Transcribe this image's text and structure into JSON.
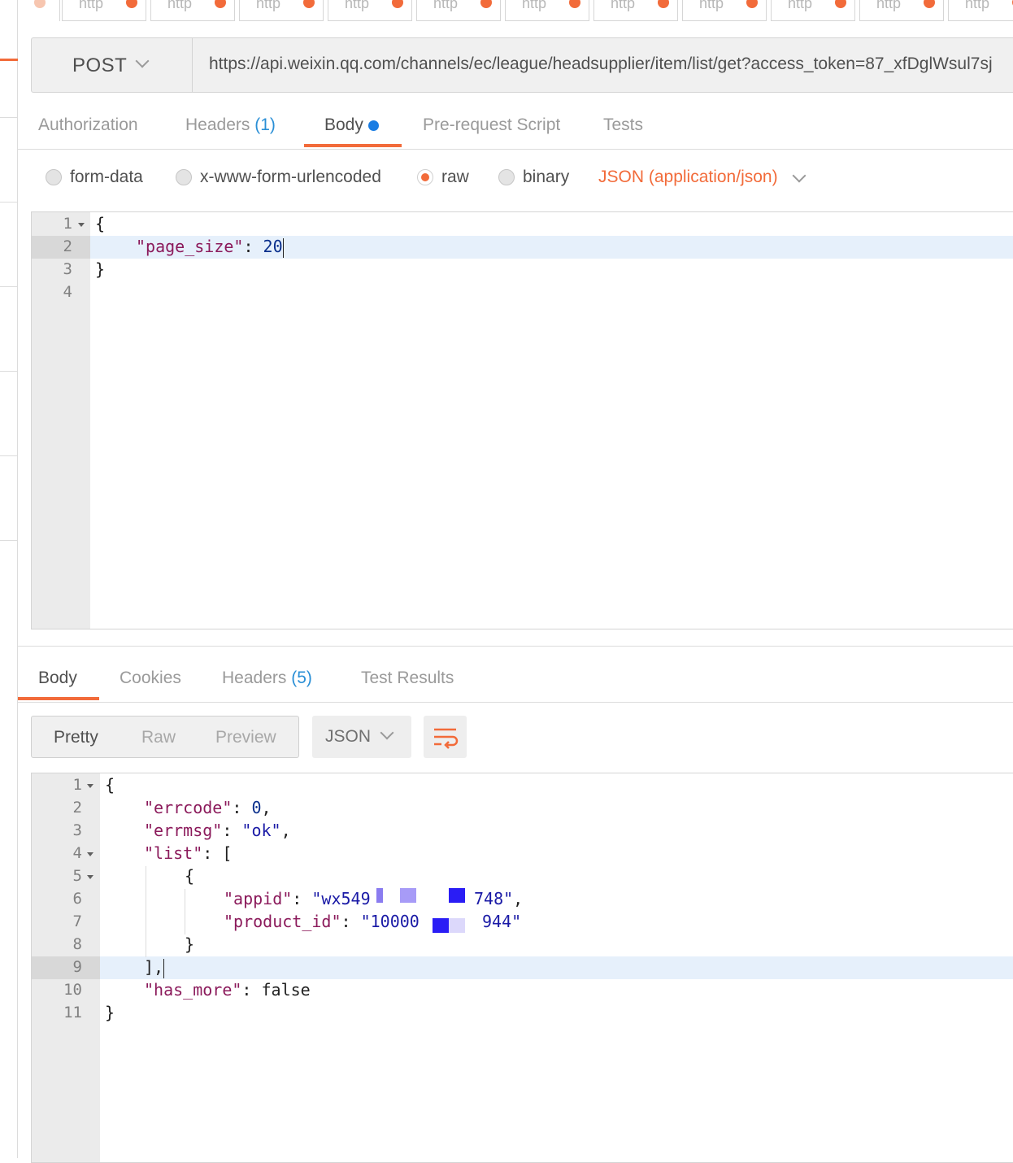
{
  "colors": {
    "accent": "#f26b3a",
    "link": "#2a8fd6",
    "dot_blue": "#1a7de3"
  },
  "tabs_strip": {
    "tab_label": "http",
    "count": 11
  },
  "request": {
    "method": "POST",
    "url": "https://api.weixin.qq.com/channels/ec/league/headsupplier/item/list/get?access_token=87_xfDglWsul7sj"
  },
  "request_tabs": [
    {
      "label": "Authorization",
      "count": ""
    },
    {
      "label": "Headers",
      "count": "(1)"
    },
    {
      "label": "Body",
      "count": "",
      "active": true,
      "dot": true
    },
    {
      "label": "Pre-request Script",
      "count": ""
    },
    {
      "label": "Tests",
      "count": ""
    }
  ],
  "body_types": {
    "form_data": "form-data",
    "urlencoded": "x-www-form-urlencoded",
    "raw": "raw",
    "binary": "binary",
    "selected": "raw",
    "content_type": "JSON (application/json)"
  },
  "request_body": {
    "line_numbers": [
      "1",
      "2",
      "3",
      "4"
    ],
    "open": "{",
    "key": "\"page_size\"",
    "colon": ": ",
    "value": "20",
    "close": "}"
  },
  "response_tabs": [
    {
      "label": "Body",
      "count": "",
      "active": true
    },
    {
      "label": "Cookies",
      "count": ""
    },
    {
      "label": "Headers",
      "count": "(5)"
    },
    {
      "label": "Test Results",
      "count": ""
    }
  ],
  "response_view": {
    "modes": [
      "Pretty",
      "Raw",
      "Preview"
    ],
    "active_mode": "Pretty",
    "format": "JSON"
  },
  "response_body": {
    "line_numbers": [
      "1",
      "2",
      "3",
      "4",
      "5",
      "6",
      "7",
      "8",
      "9",
      "10",
      "11"
    ],
    "open": "{",
    "errcode_key": "\"errcode\"",
    "errcode_val": "0",
    "errmsg_key": "\"errmsg\"",
    "errmsg_val": "\"ok\"",
    "list_key": "\"list\"",
    "list_open": "[",
    "obj_open": "{",
    "appid_key": "\"appid\"",
    "appid_val_start": "\"wx549",
    "appid_val_end": "748\"",
    "product_key": "\"product_id\"",
    "product_val_start": "\"10000",
    "product_val_end": "944\"",
    "obj_close": "}",
    "list_close": "],",
    "has_more_key": "\"has_more\"",
    "has_more_val": "false",
    "close": "}"
  }
}
